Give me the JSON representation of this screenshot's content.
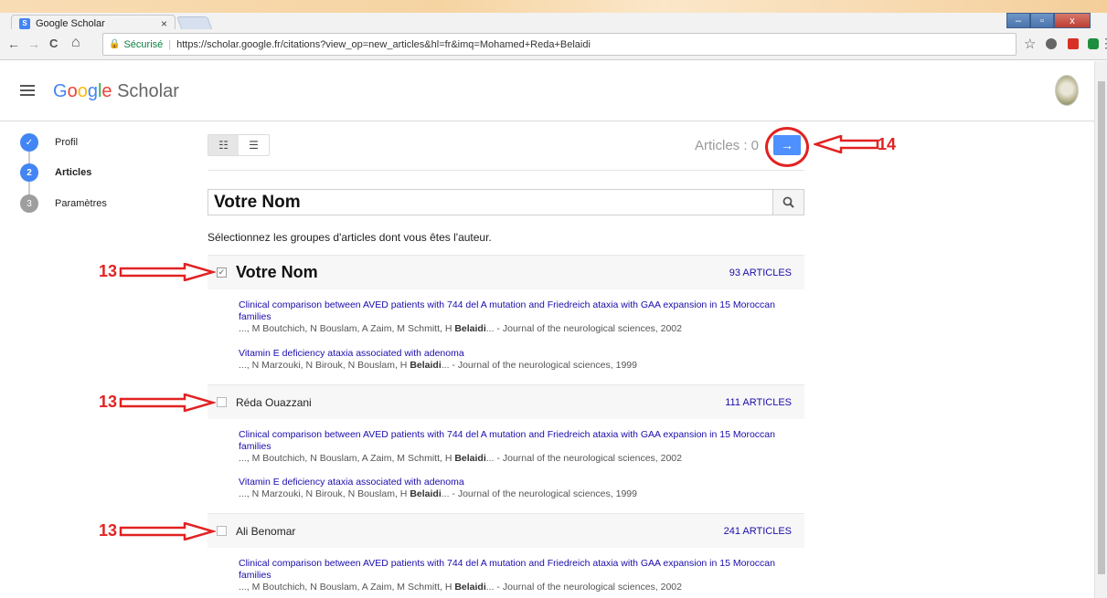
{
  "browser": {
    "tab_title": "Google Scholar",
    "tab_close": "×",
    "secure_label": "Sécurisé",
    "url": "https://scholar.google.fr/citations?view_op=new_articles&hl=fr&imq=Mohamed+Reda+Belaidi",
    "nav_back": "←",
    "nav_forward": "→",
    "nav_reload": "C",
    "nav_home": "⌂",
    "star": "☆",
    "menu": "⋮",
    "win_min": "–",
    "win_max": "▫",
    "win_close": "x"
  },
  "header": {
    "logo_parts": [
      "G",
      "o",
      "o",
      "g",
      "l",
      "e"
    ],
    "logo_suffix": " Scholar"
  },
  "stepper": {
    "steps": [
      {
        "num": "✓",
        "label": "Profil"
      },
      {
        "num": "2",
        "label": "Articles"
      },
      {
        "num": "3",
        "label": "Paramètres"
      }
    ]
  },
  "toolbar": {
    "articles_count": "Articles : 0",
    "next_label": "→"
  },
  "search": {
    "value": "Votre Nom",
    "icon": "🔍"
  },
  "instructions": "Sélectionnez les groupes d'articles dont vous êtes l'auteur.",
  "groups": [
    {
      "name": "Votre Nom",
      "count": "93 ARTICLES",
      "checked": "✓",
      "articles": [
        {
          "title": "Clinical comparison between AVED patients with 744 del A mutation and Friedreich ataxia with GAA expansion in 15 Moroccan families",
          "authors_pre": "..., M Boutchich, N Bouslam, A Zaim, M Schmitt, H ",
          "authors_bold": "Belaidi",
          "authors_post": "... - Journal of the neurological sciences, 2002"
        },
        {
          "title": "Vitamin E deficiency ataxia associated with adenoma",
          "authors_pre": "..., N Marzouki, N Birouk, N Bouslam, H ",
          "authors_bold": "Belaidi",
          "authors_post": "... - Journal of the neurological sciences, 1999"
        }
      ]
    },
    {
      "name": "Réda Ouazzani",
      "count": "111 ARTICLES",
      "checked": "",
      "articles": [
        {
          "title": "Clinical comparison between AVED patients with 744 del A mutation and Friedreich ataxia with GAA expansion in 15 Moroccan families",
          "authors_pre": "..., M Boutchich, N Bouslam, A Zaim, M Schmitt, H ",
          "authors_bold": "Belaidi",
          "authors_post": "... - Journal of the neurological sciences, 2002"
        },
        {
          "title": "Vitamin E deficiency ataxia associated with adenoma",
          "authors_pre": "..., N Marzouki, N Birouk, N Bouslam, H ",
          "authors_bold": "Belaidi",
          "authors_post": "... - Journal of the neurological sciences, 1999"
        }
      ]
    },
    {
      "name": "Ali Benomar",
      "count": "241 ARTICLES",
      "checked": "",
      "articles": [
        {
          "title": "Clinical comparison between AVED patients with 744 del A mutation and Friedreich ataxia with GAA expansion in 15 Moroccan families",
          "authors_pre": "..., M Boutchich, N Bouslam, A Zaim, M Schmitt, H ",
          "authors_bold": "Belaidi",
          "authors_post": "... - Journal of the neurological sciences, 2002"
        }
      ]
    }
  ],
  "annotations": {
    "step13": "13",
    "step14": "14"
  },
  "colors": {
    "accent": "#4d90fe",
    "link": "#1a0dab",
    "annotation": "#e22222",
    "step_active": "#4285f4",
    "step_inactive": "#9e9e9e"
  }
}
